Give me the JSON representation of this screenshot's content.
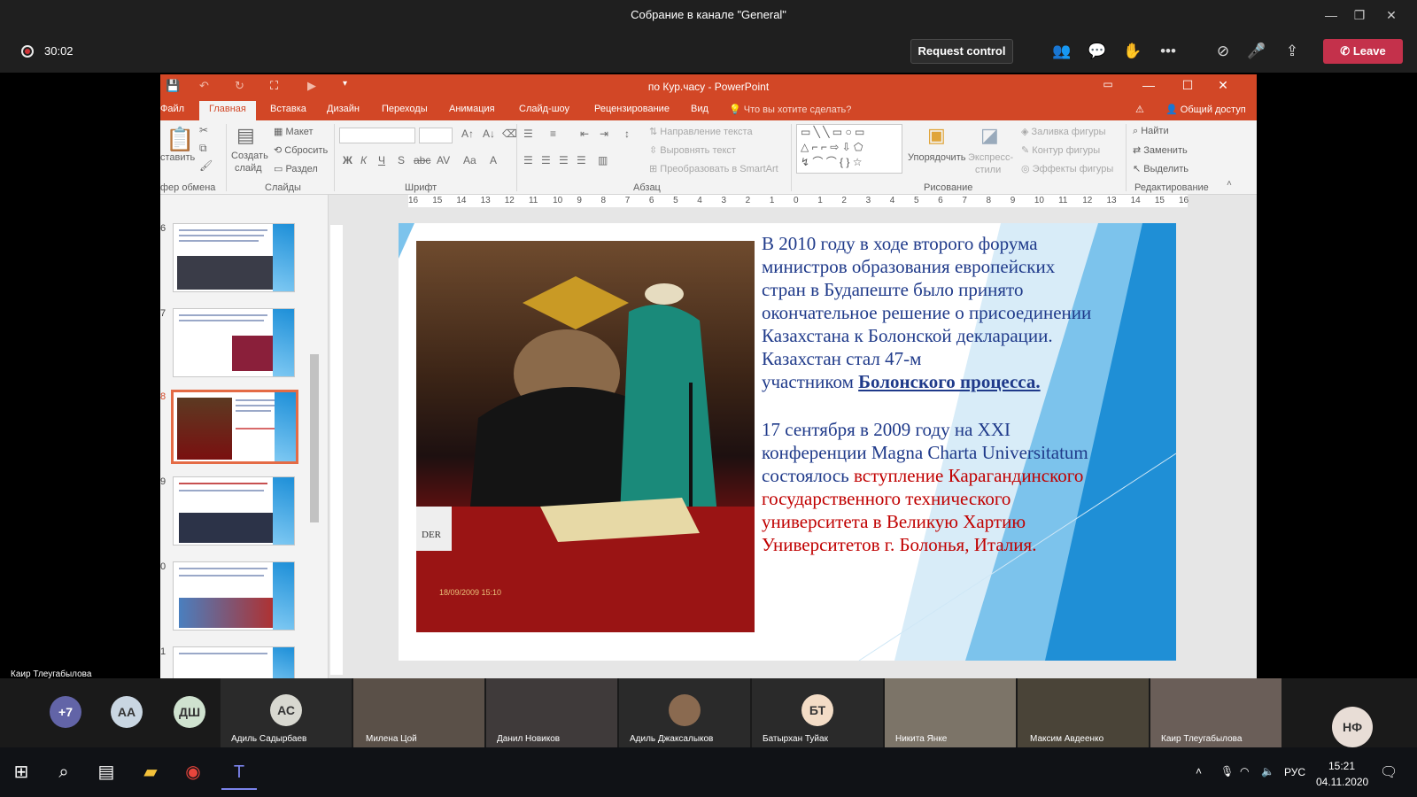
{
  "window": {
    "title": "Собрание в канале \"General\""
  },
  "meeting": {
    "timer": "30:02",
    "request_control": "Request control",
    "leave": "Leave",
    "speaker_name": "Каир Тлеугабылова"
  },
  "ppt": {
    "doc_title": "по Кур.часу - PowerPoint",
    "tabs": [
      "Файл",
      "Главная",
      "Вставка",
      "Дизайн",
      "Переходы",
      "Анимация",
      "Слайд-шоу",
      "Рецензирование",
      "Вид"
    ],
    "tell_me": "Что вы хотите сделать?",
    "share": "Общий доступ",
    "ribbon": {
      "paste": "ставить",
      "clipboard_group": "фер обмена",
      "new_slide_1": "Создать",
      "new_slide_2": "слайд",
      "layout": "Макет",
      "reset": "Сбросить",
      "section": "Раздел",
      "slides_group": "Слайды",
      "font_group": "Шрифт",
      "text_direction": "Направление текста",
      "align_text": "Выровнять текст",
      "convert_smartart": "Преобразовать в SmartArt",
      "paragraph_group": "Абзац",
      "arrange": "Упорядочить",
      "quick_styles_1": "Экспресс-",
      "quick_styles_2": "стили",
      "shape_fill": "Заливка фигуры",
      "shape_outline": "Контур фигуры",
      "shape_effects": "Эффекты фигуры",
      "drawing_group": "Рисование",
      "find": "Найти",
      "replace": "Заменить",
      "select": "Выделить",
      "editing_group": "Редактирование"
    },
    "ruler_labels": [
      "16",
      "15",
      "14",
      "13",
      "12",
      "11",
      "10",
      "9",
      "8",
      "7",
      "6",
      "5",
      "4",
      "3",
      "2",
      "1",
      "0",
      "1",
      "2",
      "3",
      "4",
      "5",
      "6",
      "7",
      "8",
      "9",
      "10",
      "11",
      "12",
      "13",
      "14",
      "15",
      "16"
    ],
    "slide_numbers": [
      "6",
      "7",
      "8",
      "9",
      "0",
      "1"
    ],
    "slide": {
      "p1_lines": [
        "В 2010 году  в ходе второго форума",
        "министров образования европейских",
        "стран в  Будапеште было принято",
        "окончательное решение о присоединении",
        "Казахстана к Болонской декларации.",
        "Казахстан  стал 47-м"
      ],
      "p1_last_prefix": "участником ",
      "p1_last_link": "Болонского процесса.",
      "p2_line1": "17 сентября в 2009 году на XXI",
      "p2_line2": "конференции Magna Charta Universitatum",
      "p2_line3_blue": "состоялось ",
      "p2_line3_red": "вступление Карагандинского",
      "p2_red_lines": [
        "государственного технического",
        "университета в Великую Хартию",
        "Университетов г. Болонья, Италия."
      ],
      "photo_caption": "DER",
      "photo_date": "18/09/2009 15:10"
    }
  },
  "participants": [
    {
      "initials": "+7",
      "name": ""
    },
    {
      "initials": "АА",
      "name": ""
    },
    {
      "initials": "ДШ",
      "name": ""
    },
    {
      "initials": "АС",
      "name": "Адиль Садырбаев"
    },
    {
      "initials": "",
      "name": "Милена Цой"
    },
    {
      "initials": "",
      "name": "Данил Новиков"
    },
    {
      "initials": "",
      "name": "Адиль Джаксалыков"
    },
    {
      "initials": "БТ",
      "name": "Батырхан Туйак"
    },
    {
      "initials": "",
      "name": "Никита Янке"
    },
    {
      "initials": "",
      "name": "Максим Авдеенко"
    },
    {
      "initials": "",
      "name": "Каир Тлеугабылова"
    },
    {
      "initials": "НФ",
      "name": ""
    }
  ],
  "taskbar": {
    "lang": "РУС",
    "time": "15:21",
    "date": "04.11.2020"
  },
  "colors": {
    "ppt_accent": "#d24726",
    "teams_leave": "#c4314b",
    "slide_text": "#1f3a8a",
    "slide_red": "#c00000"
  }
}
